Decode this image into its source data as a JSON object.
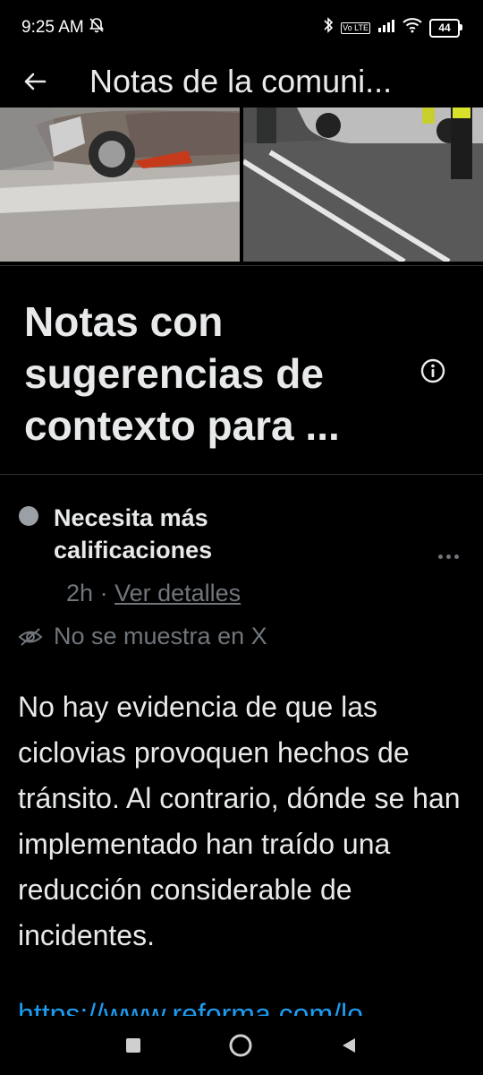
{
  "status_bar": {
    "time": "9:25 AM",
    "battery": "44",
    "volte": "Vo LTE"
  },
  "header": {
    "title": "Notas de la comuni..."
  },
  "section": {
    "title": "Notas con sugerencias de contexto para ..."
  },
  "note": {
    "status": "Necesita más calificaciones",
    "age": "2h",
    "separator": "·",
    "details_link": "Ver detalles",
    "visibility": "No se muestra en X",
    "body": "No hay evidencia de que las ciclovias provoquen hechos de tránsito. Al contrario, dónde se han implementado han traído una reducción considerable de incidentes.",
    "link": "https://www.reforma.com/lo"
  },
  "icons": {
    "back": "arrow-left-icon",
    "info": "info-icon",
    "more": "more-horizontal-icon",
    "hidden": "eye-off-icon",
    "nav_recents": "square-icon",
    "nav_home": "circle-icon",
    "nav_back": "triangle-icon"
  },
  "colors": {
    "background": "#000000",
    "text": "#e7e9ea",
    "secondary_text": "#71767b",
    "link": "#1d9bf0",
    "divider": "#2f3336",
    "status_dot": "#9aa0a6"
  }
}
